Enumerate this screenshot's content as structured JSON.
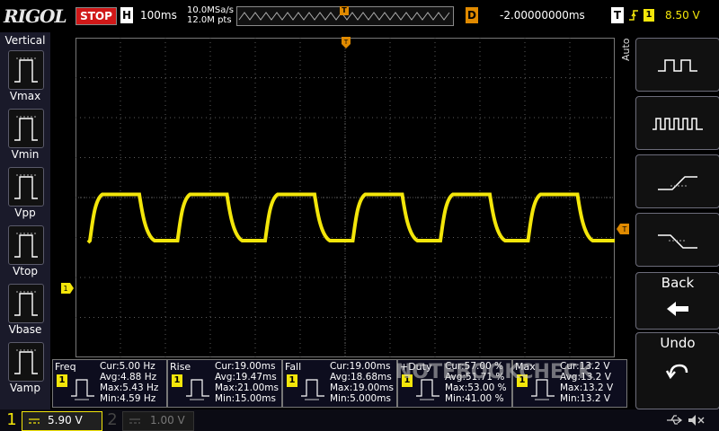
{
  "topbar": {
    "brand": "RIGOL",
    "run_state": "STOP",
    "h_label": "H",
    "timebase": "100ms",
    "sample_rate": "10.0MSa/s",
    "memory_depth": "12.0M pts",
    "trigger_marker": "T",
    "delay_label": "D",
    "delay_value": "-2.00000000ms",
    "trigger_label": "T",
    "trigger_edge_icon": "rising-edge-icon",
    "trigger_channel": "1",
    "trigger_level": "8.50 V"
  },
  "left_panel": {
    "title": "Vertical",
    "items": [
      {
        "label": "Vmax",
        "icon": "vmax-icon"
      },
      {
        "label": "Vmin",
        "icon": "vmin-icon"
      },
      {
        "label": "Vpp",
        "icon": "vpp-icon"
      },
      {
        "label": "Vtop",
        "icon": "vtop-icon"
      },
      {
        "label": "Vbase",
        "icon": "vbase-icon"
      },
      {
        "label": "Vamp",
        "icon": "vamp-icon"
      }
    ]
  },
  "right_panel": {
    "mode_label": "Auto",
    "buttons": [
      {
        "name": "period-measure",
        "icon": "square-wave-icon"
      },
      {
        "name": "freq-measure",
        "icon": "dense-square-wave-icon"
      },
      {
        "name": "rise-measure",
        "icon": "rising-edge-icon"
      },
      {
        "name": "fall-measure",
        "icon": "falling-edge-icon"
      }
    ],
    "back_label": "Back",
    "back_icon": "arrow-left-icon",
    "undo_label": "Undo",
    "undo_icon": "undo-icon"
  },
  "waveform": {
    "channel": "1",
    "channel_marker": "1",
    "trigger_level_marker": "T",
    "color": "#f3e60a",
    "high_fraction": 0.505,
    "low_fraction": 0.635
  },
  "measurements": [
    {
      "name": "Freq",
      "channel": "1",
      "cur": "Cur:5.00 Hz",
      "avg": "Avg:4.88 Hz",
      "max": "Max:5.43 Hz",
      "min": "Min:4.59 Hz"
    },
    {
      "name": "Rise",
      "channel": "1",
      "cur": "Cur:19.00ms",
      "avg": "Avg:19.47ms",
      "max": "Max:21.00ms",
      "min": "Min:15.00ms"
    },
    {
      "name": "Fall",
      "channel": "1",
      "cur": "Cur:19.00ms",
      "avg": "Avg:18.68ms",
      "max": "Max:19.00ms",
      "min": "Min:5.000ms"
    },
    {
      "name": "+Duty",
      "channel": "1",
      "cur": "Cur:57.00 %",
      "avg": "Avg:51.71 %",
      "max": "Max:53.00 %",
      "min": "Min:41.00 %"
    },
    {
      "name": "Max",
      "channel": "1",
      "cur": "Cur:13.2 V",
      "avg": "Avg:13.2 V",
      "max": "Max:13.2 V",
      "min": "Min:13.2 V"
    }
  ],
  "bottombar": {
    "ch1_number": "1",
    "ch1_scale": "5.90 V",
    "ch2_number": "2",
    "ch2_scale": "1.00 V",
    "usb_icon": "usb-icon",
    "speaker_icon": "speaker-muted-icon"
  },
  "watermark": "NOTEBOOKCHECK",
  "colors": {
    "ch1": "#f3e60a",
    "trigger": "#e08a00",
    "stop": "#d01818",
    "grid": "#5a5a5a"
  }
}
